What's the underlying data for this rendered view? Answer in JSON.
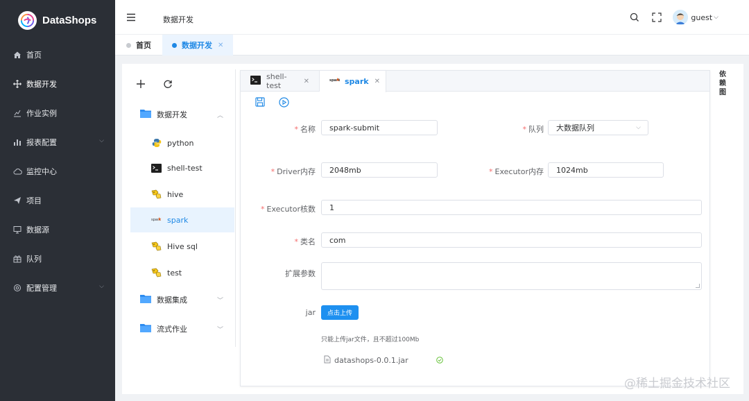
{
  "app": {
    "name": "DataShops"
  },
  "sidebar": {
    "items": [
      {
        "label": "首页",
        "icon": "home-icon",
        "has_arrow": false
      },
      {
        "label": "数据开发",
        "icon": "move-icon",
        "has_arrow": false
      },
      {
        "label": "作业实例",
        "icon": "stats-icon",
        "has_arrow": false
      },
      {
        "label": "报表配置",
        "icon": "bar-chart-icon",
        "has_arrow": true
      },
      {
        "label": "监控中心",
        "icon": "cloud-icon",
        "has_arrow": false
      },
      {
        "label": "项目",
        "icon": "send-icon",
        "has_arrow": false
      },
      {
        "label": "数据源",
        "icon": "monitor-icon",
        "has_arrow": false
      },
      {
        "label": "队列",
        "icon": "gift-icon",
        "has_arrow": false
      },
      {
        "label": "配置管理",
        "icon": "settings-icon",
        "has_arrow": true
      }
    ]
  },
  "header": {
    "breadcrumb": "数据开发",
    "user": "guest"
  },
  "tags": [
    {
      "label": "首页",
      "active": false
    },
    {
      "label": "数据开发",
      "active": true,
      "closable": true
    }
  ],
  "tree": {
    "folders": [
      {
        "label": "数据开发",
        "expanded": true
      },
      {
        "label": "数据集成",
        "expanded": false
      },
      {
        "label": "流式作业",
        "expanded": false
      }
    ],
    "items": [
      {
        "label": "python",
        "icon": "python-icon"
      },
      {
        "label": "shell-test",
        "icon": "terminal-icon"
      },
      {
        "label": "hive",
        "icon": "hive-icon"
      },
      {
        "label": "spark",
        "icon": "spark-icon",
        "selected": true
      },
      {
        "label": "Hive sql",
        "icon": "hive-icon"
      },
      {
        "label": "test",
        "icon": "hive-icon"
      }
    ]
  },
  "editor": {
    "tabs": [
      {
        "label": "shell-test",
        "icon": "terminal-icon",
        "active": false
      },
      {
        "label": "spark",
        "icon": "spark-icon",
        "active": true
      }
    ],
    "form": {
      "name_label": "名称",
      "name_value": "spark-submit",
      "queue_label": "队列",
      "queue_value": "大数据队列",
      "driver_mem_label": "Driver内存",
      "driver_mem_value": "2048mb",
      "executor_mem_label": "Executor内存",
      "executor_mem_value": "1024mb",
      "executor_cores_label": "Executor核数",
      "executor_cores_value": "1",
      "class_label": "类名",
      "class_value": "com",
      "ext_params_label": "扩展参数",
      "ext_params_value": "",
      "jar_label": "jar",
      "upload_label": "点击上传",
      "upload_tip": "只能上传jar文件，且不超过100Mb",
      "file_name": "datashops-0.0.1.jar"
    }
  },
  "side_label": "依赖图",
  "watermark": "@稀土掘金技术社区",
  "colors": {
    "accent": "#1e88e5",
    "sidebar_bg": "#2b2f36",
    "required": "#f56c6c"
  }
}
